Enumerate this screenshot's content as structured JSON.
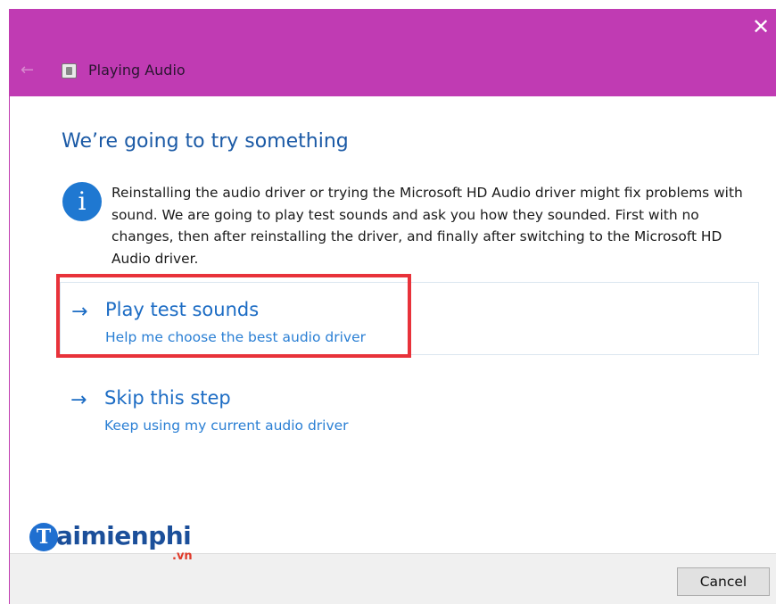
{
  "window": {
    "title": "Playing Audio",
    "back_glyph": "←",
    "close_glyph": "✕",
    "accent_color": "#c03bb3"
  },
  "content": {
    "heading": "We’re going to try something",
    "info_glyph": "i",
    "info_text": "Reinstalling the audio driver or trying the Microsoft HD Audio driver might fix problems with sound. We are going to play test sounds and ask you how they sounded. First with no changes, then after reinstalling the driver, and finally after switching to the Microsoft HD Audio driver.",
    "options": [
      {
        "arrow": "→",
        "title": "Play test sounds",
        "subtitle": "Help me choose the best audio driver"
      },
      {
        "arrow": "→",
        "title": "Skip this step",
        "subtitle": "Keep using my current audio driver"
      }
    ]
  },
  "footer": {
    "cancel_label": "Cancel"
  },
  "watermark": {
    "logo_letter": "T",
    "word": "aimienphi",
    "suffix": ".vn"
  },
  "icons": {
    "back": "back-arrow-icon",
    "app": "audio-troubleshooter-icon",
    "close": "close-icon",
    "info": "info-icon",
    "option_arrow": "arrow-right-icon"
  },
  "colors": {
    "title_bar": "#c03bb3",
    "link_blue": "#1c6cc4",
    "heading_blue": "#1b5aa6",
    "highlight_red": "#e8323a"
  }
}
